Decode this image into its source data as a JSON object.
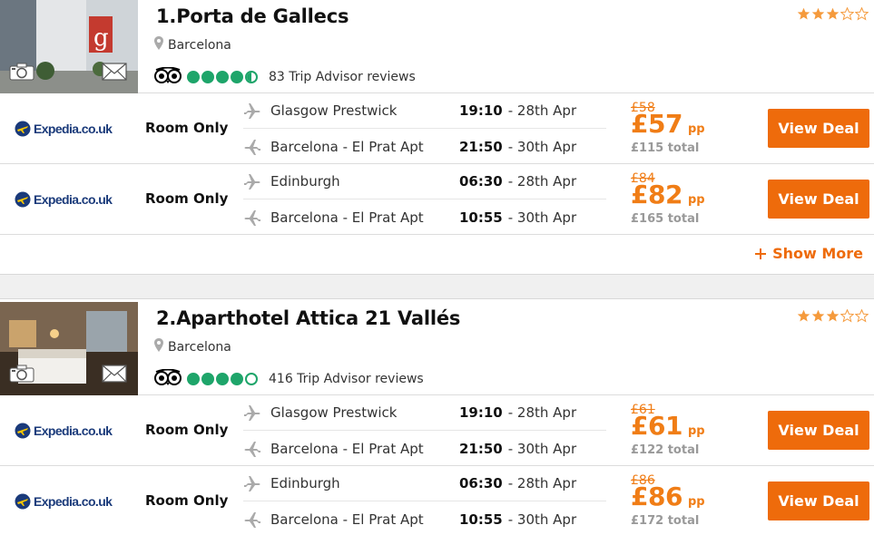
{
  "colors": {
    "accent": "#ee6b0b",
    "price": "#f07d16",
    "tripadvisor_green": "#1ea56a",
    "star": "#f59a3c",
    "provider": "#1a3a7a"
  },
  "hotels": [
    {
      "title": "1.Porta de Gallecs",
      "location": "Barcelona",
      "reviews": "83 Trip Advisor reviews",
      "tripadvisor_rating": 4.5,
      "star_rating": 3,
      "deals": [
        {
          "provider": "Expedia.co.uk",
          "board": "Room Only",
          "outbound": {
            "airport": "Glasgow Prestwick",
            "time": "19:10",
            "date": "- 28th Apr"
          },
          "return": {
            "airport": "Barcelona - El Prat Apt",
            "time": "21:50",
            "date": "- 30th Apr"
          },
          "was_price": "£58",
          "price": "£57",
          "pp": "pp",
          "total": "£115 total",
          "button": "View Deal"
        },
        {
          "provider": "Expedia.co.uk",
          "board": "Room Only",
          "outbound": {
            "airport": "Edinburgh",
            "time": "06:30",
            "date": "- 28th Apr"
          },
          "return": {
            "airport": "Barcelona - El Prat Apt",
            "time": "10:55",
            "date": "- 30th Apr"
          },
          "was_price": "£84",
          "price": "£82",
          "pp": "pp",
          "total": "£165 total",
          "button": "View Deal"
        }
      ],
      "show_more": "Show More"
    },
    {
      "title": "2.Aparthotel Attica 21 Vallés",
      "location": "Barcelona",
      "reviews": "416 Trip Advisor reviews",
      "tripadvisor_rating": 4,
      "star_rating": 3,
      "deals": [
        {
          "provider": "Expedia.co.uk",
          "board": "Room Only",
          "outbound": {
            "airport": "Glasgow Prestwick",
            "time": "19:10",
            "date": "- 28th Apr"
          },
          "return": {
            "airport": "Barcelona - El Prat Apt",
            "time": "21:50",
            "date": "- 30th Apr"
          },
          "was_price": "£61",
          "price": "£61",
          "pp": "pp",
          "total": "£122 total",
          "button": "View Deal"
        },
        {
          "provider": "Expedia.co.uk",
          "board": "Room Only",
          "outbound": {
            "airport": "Edinburgh",
            "time": "06:30",
            "date": "- 28th Apr"
          },
          "return": {
            "airport": "Barcelona - El Prat Apt",
            "time": "10:55",
            "date": "- 30th Apr"
          },
          "was_price": "£86",
          "price": "£86",
          "pp": "pp",
          "total": "£172 total",
          "button": "View Deal"
        }
      ]
    }
  ],
  "icons": [
    "camera-icon",
    "mail-icon",
    "location-pin-icon",
    "tripadvisor-owl-icon",
    "star-icon",
    "plane-takeoff-icon",
    "plane-landing-icon",
    "expedia-plane-icon",
    "plus-icon"
  ]
}
